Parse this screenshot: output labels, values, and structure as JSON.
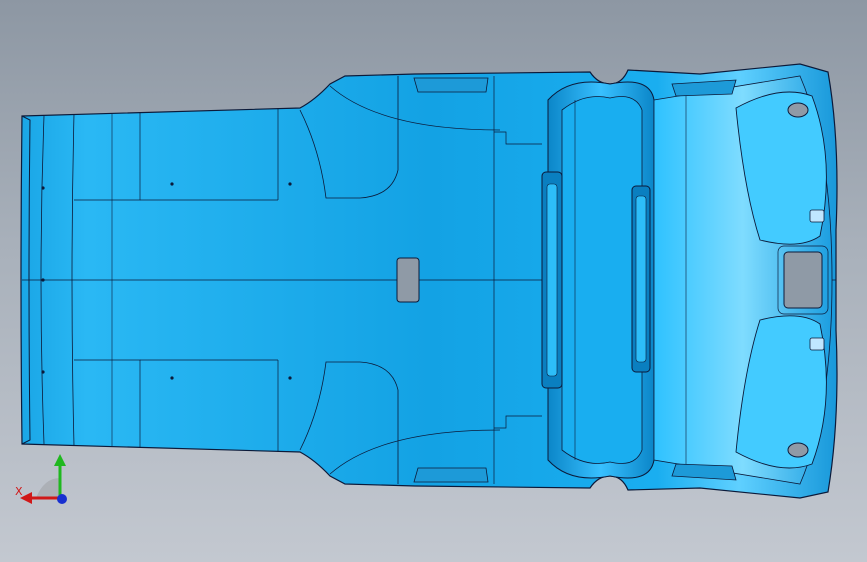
{
  "view": {
    "background_top": "#8d97a3",
    "background_bottom": "#c3c8d0",
    "model_fill": "#12a8ea",
    "model_edge": "#0b1a3a",
    "cutout_fill": "#8f9aa6"
  },
  "triad": {
    "x_label": "X",
    "x_color": "#d01818",
    "y_color": "#1fb81f",
    "z_color": "#1830d0"
  }
}
